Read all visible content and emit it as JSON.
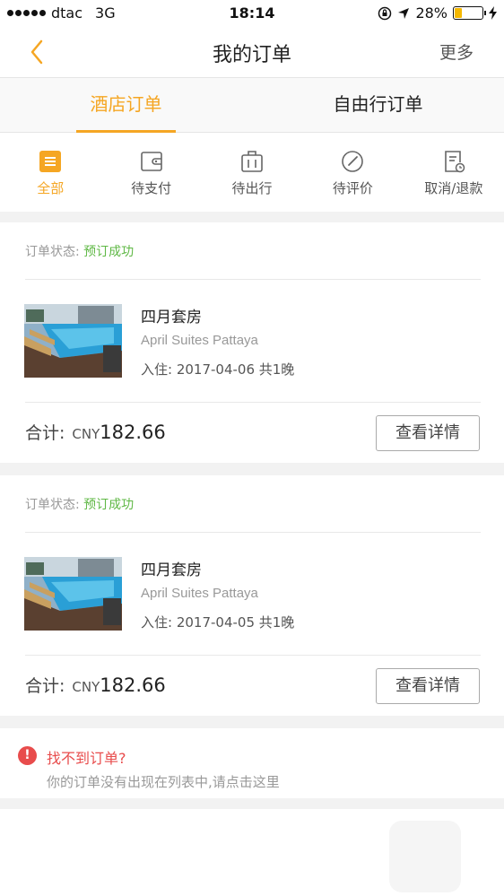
{
  "status_bar": {
    "carrier": "dtac",
    "network": "3G",
    "time": "18:14",
    "battery": "28%",
    "battery_level": 0.28
  },
  "navbar": {
    "title": "我的订单",
    "more": "更多"
  },
  "type_tabs": [
    {
      "label": "酒店订单",
      "active": true
    },
    {
      "label": "自由行订单",
      "active": false
    }
  ],
  "status_tabs": [
    {
      "label": "全部",
      "icon": "list-icon",
      "active": true
    },
    {
      "label": "待支付",
      "icon": "wallet-icon",
      "active": false
    },
    {
      "label": "待出行",
      "icon": "luggage-icon",
      "active": false
    },
    {
      "label": "待评价",
      "icon": "pen-circle-icon",
      "active": false
    },
    {
      "label": "取消/退款",
      "icon": "document-clock-icon",
      "active": false
    }
  ],
  "orders": [
    {
      "status_label": "订单状态:",
      "status_value": "预订成功",
      "hotel_name": "四月套房",
      "hotel_name_en": "April Suites Pattaya",
      "stay": "入住: 2017-04-06 共1晚",
      "total_label": "合计:",
      "currency": "CNY",
      "amount": "182.66",
      "detail_button": "查看详情"
    },
    {
      "status_label": "订单状态:",
      "status_value": "预订成功",
      "hotel_name": "四月套房",
      "hotel_name_en": "April Suites Pattaya",
      "stay": "入住: 2017-04-05 共1晚",
      "total_label": "合计:",
      "currency": "CNY",
      "amount": "182.66",
      "detail_button": "查看详情"
    }
  ],
  "help": {
    "icon": "!",
    "title": "找不到订单?",
    "subtitle": "你的订单没有出现在列表中,请点击这里"
  },
  "colors": {
    "accent": "#f5a623",
    "success": "#5fb845",
    "warning": "#e84c4c"
  }
}
